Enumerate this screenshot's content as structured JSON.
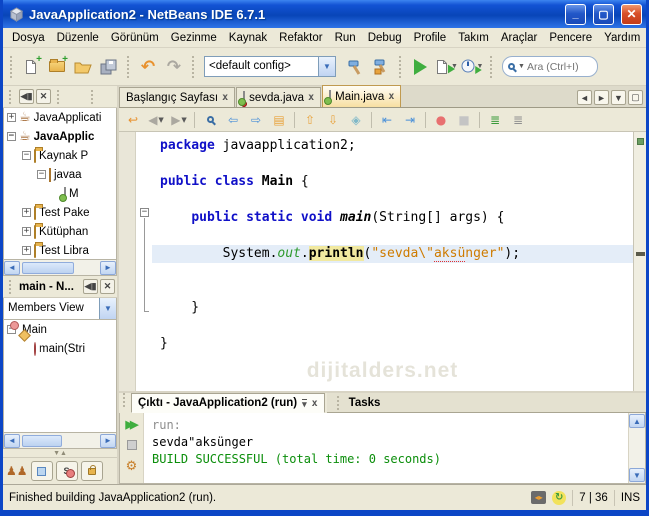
{
  "window": {
    "title": "JavaApplication2 - NetBeans IDE 6.7.1",
    "controls": [
      "minimize-button",
      "maximize-button",
      "close-button"
    ]
  },
  "menu_bar": {
    "items": [
      "Dosya",
      "Düzenle",
      "Görünüm",
      "Gezinme",
      "Kaynak",
      "Refaktor",
      "Run",
      "Debug",
      "Profile",
      "Takım",
      "Araçlar",
      "Pencere",
      "Yardım"
    ]
  },
  "toolbar": {
    "groups": [
      [
        "new-file",
        "new-project",
        "open-project",
        "save-all"
      ],
      [
        "undo",
        "redo"
      ]
    ],
    "config_value": "<default config>",
    "build_group": [
      "build",
      "clean-build"
    ],
    "run_group": [
      "run",
      "debug",
      "profile"
    ],
    "search_placeholder": "Ara (Ctrl+I)"
  },
  "projects_panel": {
    "header_icons": [
      "collapse-window-icon",
      "close-icon"
    ],
    "items": [
      {
        "label": "JavaApplicati",
        "depth": 0,
        "expander": "plus",
        "icon": "project-icon",
        "bold": false
      },
      {
        "label": "JavaApplic",
        "depth": 0,
        "expander": "minus",
        "icon": "project-icon",
        "bold": true
      },
      {
        "label": "Kaynak P",
        "depth": 1,
        "expander": "minus",
        "icon": "folder-icon",
        "bold": false
      },
      {
        "label": "javaa",
        "depth": 2,
        "expander": "minus",
        "icon": "package-icon",
        "bold": false
      },
      {
        "label": "M",
        "depth": 3,
        "expander": "none",
        "icon": "java-file-icon",
        "bold": false
      },
      {
        "label": "Test Pake",
        "depth": 1,
        "expander": "plus",
        "icon": "folder-icon",
        "bold": false
      },
      {
        "label": "Kütüphan",
        "depth": 1,
        "expander": "plus",
        "icon": "folder-icon",
        "bold": false
      },
      {
        "label": "Test Libra",
        "depth": 1,
        "expander": "plus",
        "icon": "folder-icon",
        "bold": false
      }
    ]
  },
  "navigator": {
    "title": "main - N...",
    "view_selector": "Members View",
    "items": [
      {
        "label": "Main",
        "depth": 0,
        "expander": "minus",
        "icon": "class-icon"
      },
      {
        "label": "main(Stri",
        "depth": 1,
        "expander": "none",
        "icon": "method-icon"
      }
    ],
    "filter_icons": [
      "inherited-members-icon",
      "show-fields-filter",
      "show-static-members-filter",
      "show-non-public-filter"
    ]
  },
  "editor": {
    "tabs": [
      {
        "label": "Başlangıç Sayfası",
        "icon": null,
        "active": false
      },
      {
        "label": "sevda.java",
        "icon": "java-file-error-icon",
        "active": false
      },
      {
        "label": "Main.java",
        "icon": "java-file-run-icon",
        "active": true
      }
    ],
    "toolbar_icons": [
      "last-edit-location",
      "back",
      "forward",
      "find-selection",
      "find-previous",
      "find-next",
      "toggle-highlight",
      "previous-occurrence",
      "next-occurrence",
      "toggle-bookmark",
      "shift-line-left",
      "shift-line-right",
      "start-macro-recording",
      "stop-macro-recording",
      "comment",
      "uncomment"
    ],
    "watermark": "dijitalders.net",
    "code_lines": [
      {
        "segments": [
          {
            "t": "package",
            "c": "kw"
          },
          {
            "t": " javaapplication2;",
            "c": "pl"
          }
        ]
      },
      {
        "segments": []
      },
      {
        "segments": [
          {
            "t": "public",
            "c": "kw"
          },
          {
            "t": " ",
            "c": "pl"
          },
          {
            "t": "class",
            "c": "kw"
          },
          {
            "t": " ",
            "c": "pl"
          },
          {
            "t": "Main",
            "c": "cls"
          },
          {
            "t": " {",
            "c": "pl"
          }
        ]
      },
      {
        "segments": []
      },
      {
        "segments": [
          {
            "t": "    ",
            "c": "pl"
          },
          {
            "t": "public",
            "c": "kw"
          },
          {
            "t": " ",
            "c": "pl"
          },
          {
            "t": "static",
            "c": "kw"
          },
          {
            "t": " ",
            "c": "pl"
          },
          {
            "t": "void",
            "c": "kw"
          },
          {
            "t": " ",
            "c": "pl"
          },
          {
            "t": "main",
            "c": "mth"
          },
          {
            "t": "(String[] args) {",
            "c": "pl"
          }
        ]
      },
      {
        "segments": []
      },
      {
        "current": true,
        "segments": [
          {
            "t": "        System.",
            "c": "pl"
          },
          {
            "t": "out",
            "c": "fld"
          },
          {
            "t": ".",
            "c": "pl"
          },
          {
            "t": "println",
            "c": "hl"
          },
          {
            "t": "(",
            "c": "pl"
          },
          {
            "t": "\"sevda\\\"",
            "c": "str"
          },
          {
            "t": "aksü",
            "c": "str typo"
          },
          {
            "t": "nger\"",
            "c": "str"
          },
          {
            "t": ");",
            "c": "pl"
          }
        ]
      },
      {
        "segments": []
      },
      {
        "segments": []
      },
      {
        "segments": [
          {
            "t": "    }",
            "c": "pl"
          }
        ]
      },
      {
        "segments": []
      },
      {
        "segments": [
          {
            "t": "}",
            "c": "pl"
          }
        ]
      }
    ]
  },
  "output": {
    "tab_label": "Çıktı - JavaApplication2 (run)",
    "tasks_label": "Tasks",
    "tool_icons": [
      "rerun-icon",
      "stop-icon",
      "ant-settings-icon"
    ],
    "lines": [
      {
        "text": "run:",
        "color": "gray"
      },
      {
        "text": "sevda\"aksünger",
        "color": "black"
      },
      {
        "text": "BUILD SUCCESSFUL (total time: 0 seconds)",
        "color": "green"
      }
    ]
  },
  "status_bar": {
    "message": "Finished building JavaApplication2 (run).",
    "icons": [
      "horizontal-arrows-icon",
      "refresh-icon"
    ],
    "caret_position": "7 | 36",
    "insert_mode": "INS"
  }
}
